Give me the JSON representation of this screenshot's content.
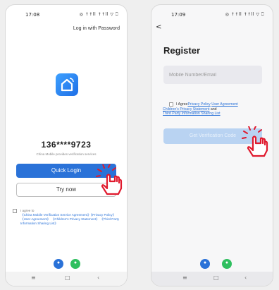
{
  "colors": {
    "primary": "#2a72d8",
    "primary_disabled": "#b9d3f2",
    "wechat_green": "#2fbf5f",
    "tap_indicator": "#e0192d"
  },
  "left_screen": {
    "status_time": "17:08",
    "status_icons": "◎ ↑↑ll ↑↑ll ▽ ⎕",
    "log_in_with_password": "Log in with Password",
    "app_logo_icon": "home-icon",
    "phone_number": "136****9723",
    "provider_text": "China Mobile provides verification services",
    "quick_login_label": "Quick Login",
    "try_now_label": "Try now",
    "agree_prefix": "I agree to",
    "agreement_links": "《China Mobile Verification Service Agreement》《Privacy Policy》 《User Agreement》 《Children's Privacy Statement》 《Third Party Information Sharing List》",
    "nav": {
      "menu": "≡",
      "home": "□",
      "back": "‹"
    }
  },
  "right_screen": {
    "status_time": "17:09",
    "status_icons": "◎ ↑↑ll ↑↑ll ▽ ⎕",
    "back": "<",
    "title": "Register",
    "input_placeholder": "Mobile Number/Email",
    "agree_prefix": "I Agree",
    "privacy_policy": "Privacy Policy",
    "user_agreement": "User Agreement",
    "childrens_privacy": "Children's Privacy Statement",
    "and": " and",
    "third_party": "Third Party Information Sharing List",
    "get_code_label": "Get Verification Code",
    "nav": {
      "menu": "≡",
      "home": "□",
      "back": "‹"
    }
  }
}
